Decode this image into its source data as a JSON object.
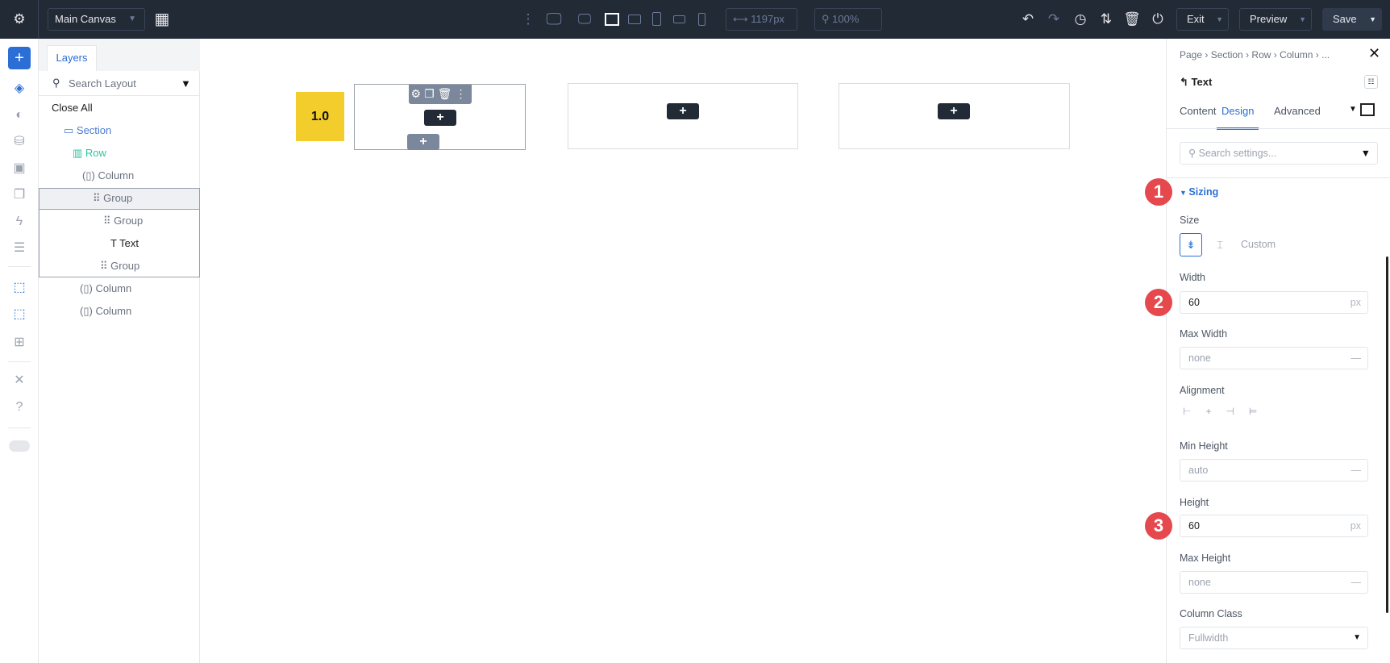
{
  "topbar": {
    "canvas_select": "Main Canvas",
    "width_value": "1197px",
    "zoom_value": "100%",
    "exit": "Exit",
    "preview": "Preview",
    "save": "Save"
  },
  "layers": {
    "tab": "Layers",
    "search_placeholder": "Search Layout",
    "close_all": "Close All",
    "tree": [
      {
        "label": "Section"
      },
      {
        "label": "Row"
      },
      {
        "label": "Column"
      },
      {
        "label": "Group"
      },
      {
        "label": "Group"
      },
      {
        "label": "Text"
      },
      {
        "label": "Group"
      },
      {
        "label": "Column"
      },
      {
        "label": "Column"
      }
    ]
  },
  "canvas": {
    "version_badge": "1.0",
    "add": "+"
  },
  "panel": {
    "breadcrumb": [
      "Page",
      "Section",
      "Row",
      "Column",
      "..."
    ],
    "title": "Text",
    "tabs": [
      "Content",
      "Design",
      "Advanced"
    ],
    "active_tab": "Design",
    "search_placeholder": "Search settings...",
    "section": "Sizing",
    "size_label": "Size",
    "size_custom": "Custom",
    "width_label": "Width",
    "width_value": "60",
    "unit": "px",
    "max_width_label": "Max Width",
    "max_width_value": "none",
    "alignment_label": "Alignment",
    "min_height_label": "Min Height",
    "min_height_value": "auto",
    "height_label": "Height",
    "height_value": "60",
    "max_height_label": "Max Height",
    "max_height_value": "none",
    "column_class_label": "Column Class",
    "column_class_value": "Fullwidth",
    "badges": [
      "1",
      "2",
      "3"
    ]
  },
  "colors": {
    "accent": "#2b6fd6",
    "topbar": "#222a36",
    "badge": "#e5484d",
    "version": "#f2cd2c"
  }
}
